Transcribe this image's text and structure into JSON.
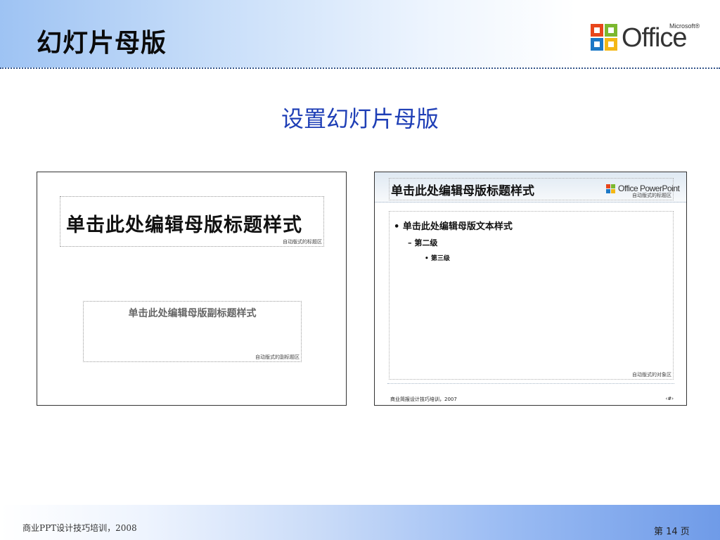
{
  "header": {
    "title": "幻灯片母版",
    "logo_text": "Office",
    "logo_superscript": "Microsoft®"
  },
  "subtitle": "设置幻灯片母版",
  "left_slide": {
    "title_placeholder_text": "单击此处编辑母版标题样式",
    "title_placeholder_label": "自动版式的标题区",
    "subtitle_placeholder_text": "单击此处编辑母版副标题样式",
    "subtitle_placeholder_label": "自动版式的副标题区"
  },
  "right_slide": {
    "title_placeholder_text": "单击此处编辑母版标题样式",
    "title_placeholder_label": "自动版式的标题区",
    "logo_text": "Office PowerPoint",
    "body_level1": "•  单击此处编辑母版文本样式",
    "body_level2": "–  第二级",
    "body_level3": "•  第三级",
    "body_placeholder_label": "自动版式的对象区",
    "footer_left": "商业简报设计技巧培训，2007",
    "footer_right": "‹#›"
  },
  "footer": {
    "left": "商业PPT设计技巧培训，2008",
    "right": "第 14 页"
  },
  "colors": {
    "subtitle": "#1f3fb6",
    "header_gradient_start": "#9ec3f3",
    "footer_gradient_end": "#6f9be8"
  }
}
